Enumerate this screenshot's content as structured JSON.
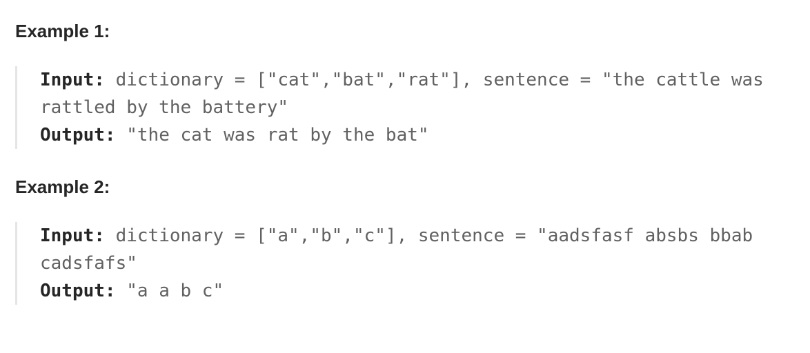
{
  "examples": [
    {
      "title": "Example 1:",
      "input_label": "Input:",
      "input_value": "dictionary = [\"cat\",\"bat\",\"rat\"], sentence = \"the cattle was rattled by the battery\"",
      "output_label": "Output:",
      "output_value": "\"the cat was rat by the bat\""
    },
    {
      "title": "Example 2:",
      "input_label": "Input:",
      "input_value": "dictionary = [\"a\",\"b\",\"c\"], sentence = \"aadsfasf absbs bbab cadsfafs\"",
      "output_label": "Output:",
      "output_value": "\"a a b c\""
    }
  ]
}
